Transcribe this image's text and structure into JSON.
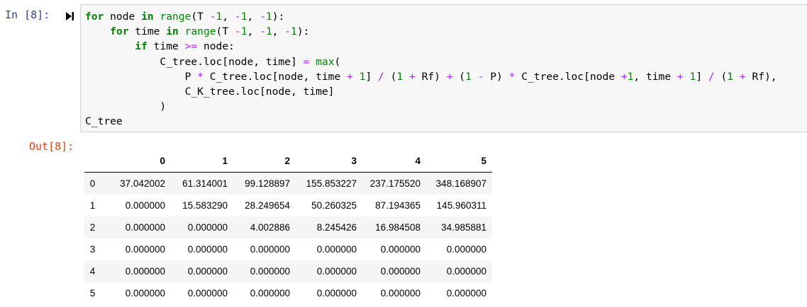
{
  "cell": {
    "in_prompt": "In [8]:",
    "out_prompt": "Out[8]:",
    "run_icon": "step-run-icon"
  },
  "code": {
    "lines": [
      "for node in range(T -1, -1, -1):",
      "    for time in range(T -1, -1, -1):",
      "        if time >= node:",
      "            C_tree.loc[node, time] = max(",
      "                P * C_tree.loc[node, time + 1] / (1 + Rf) + (1 - P) * C_tree.loc[node +1, time + 1] / (1 + Rf),",
      "                C_K_tree.loc[node, time]",
      "            )",
      "C_tree"
    ]
  },
  "dataframe": {
    "columns": [
      "",
      "0",
      "1",
      "2",
      "3",
      "4",
      "5"
    ],
    "rows": [
      [
        "0",
        "37.042002",
        "61.314001",
        "99.128897",
        "155.853227",
        "237.175520",
        "348.168907"
      ],
      [
        "1",
        "0.000000",
        "15.583290",
        "28.249654",
        "50.260325",
        "87.194365",
        "145.960311"
      ],
      [
        "2",
        "0.000000",
        "0.000000",
        "4.002886",
        "8.245426",
        "16.984508",
        "34.985881"
      ],
      [
        "3",
        "0.000000",
        "0.000000",
        "0.000000",
        "0.000000",
        "0.000000",
        "0.000000"
      ],
      [
        "4",
        "0.000000",
        "0.000000",
        "0.000000",
        "0.000000",
        "0.000000",
        "0.000000"
      ],
      [
        "5",
        "0.000000",
        "0.000000",
        "0.000000",
        "0.000000",
        "0.000000",
        "0.000000"
      ]
    ]
  }
}
